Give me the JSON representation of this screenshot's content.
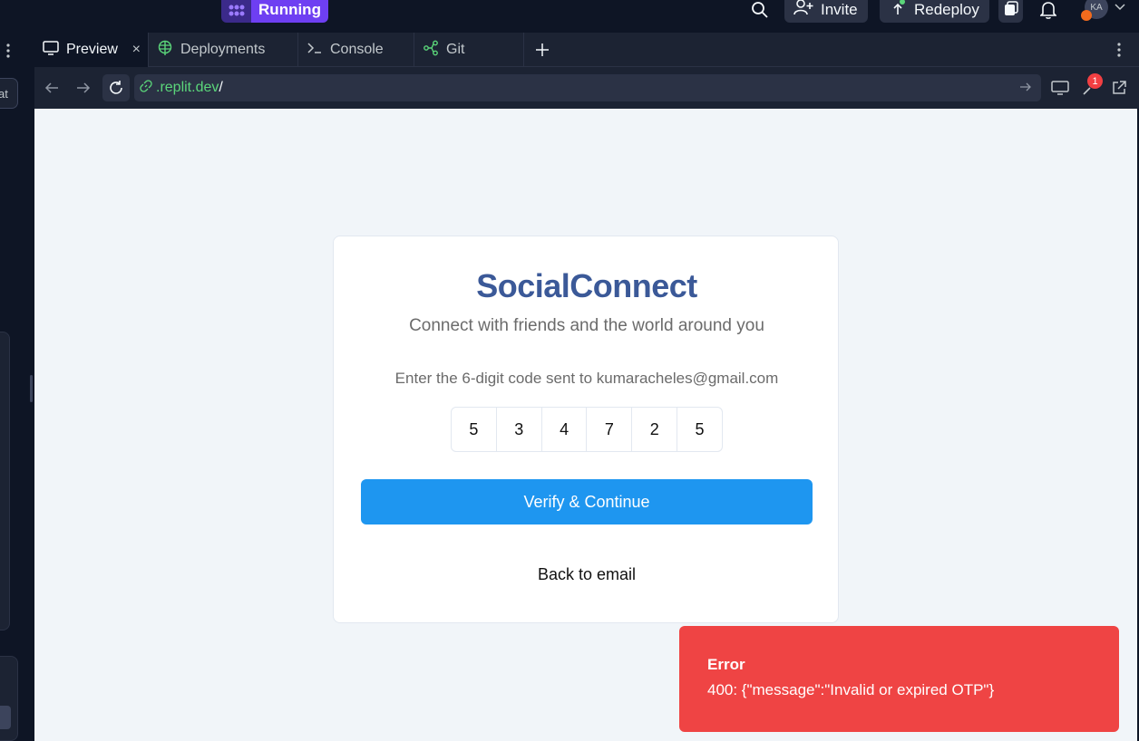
{
  "topbar": {
    "run_label": "Running",
    "invite_label": "Invite",
    "redeploy_label": "Redeploy",
    "avatar_initials": "KA"
  },
  "sidebar": {
    "chip_text": "at"
  },
  "tabs": [
    {
      "label": "Preview",
      "active": true,
      "icon": "monitor-icon"
    },
    {
      "label": "Deployments",
      "active": false,
      "icon": "globe-icon"
    },
    {
      "label": "Console",
      "active": false,
      "icon": "terminal-icon"
    },
    {
      "label": "Git",
      "active": false,
      "icon": "git-icon"
    }
  ],
  "urlbar": {
    "domain": ".replit.dev",
    "path": "/",
    "devtools_badge": "1"
  },
  "app": {
    "brand": "SocialConnect",
    "tagline": "Connect with friends and the world around you",
    "instruction": "Enter the 6-digit code sent to kumaracheles@gmail.com",
    "otp": [
      "5",
      "3",
      "4",
      "7",
      "2",
      "5"
    ],
    "verify_label": "Verify & Continue",
    "back_label": "Back to email"
  },
  "toast": {
    "title": "Error",
    "message": "400: {\"message\":\"Invalid or expired OTP\"}"
  },
  "colors": {
    "accent": "#1e96f0",
    "brand": "#3b5998",
    "error": "#ef4444",
    "run": "#6e3ff2"
  }
}
